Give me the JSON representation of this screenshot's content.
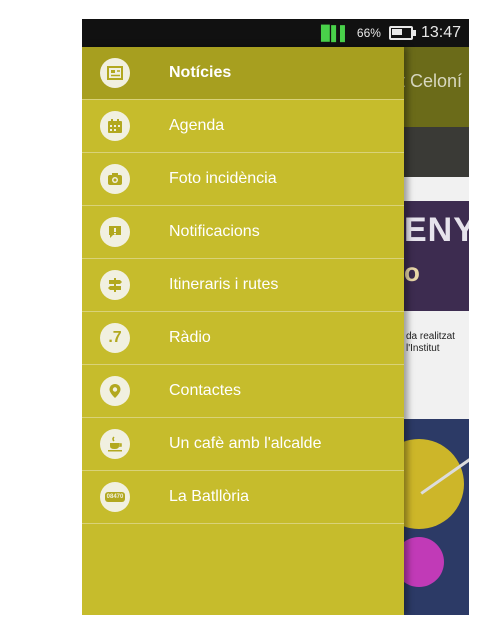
{
  "status_bar": {
    "battery_percent": "66%",
    "time": "13:47"
  },
  "background_app": {
    "title": "t Celoní",
    "banner_text": "ENY",
    "banner_sub": "o",
    "article_text": "da realitzat l'Institut"
  },
  "drawer": {
    "items": [
      {
        "label": "Notícies",
        "icon": "newspaper-icon",
        "active": true
      },
      {
        "label": "Agenda",
        "icon": "calendar-icon",
        "active": false
      },
      {
        "label": "Foto incidència",
        "icon": "camera-icon",
        "active": false
      },
      {
        "label": "Notificacions",
        "icon": "notification-icon",
        "active": false
      },
      {
        "label": "Itineraris i rutes",
        "icon": "signpost-icon",
        "active": false
      },
      {
        "label": "Ràdio",
        "icon": "radio-icon",
        "icon_text": ".7",
        "active": false
      },
      {
        "label": "Contactes",
        "icon": "location-pin-icon",
        "active": false
      },
      {
        "label": "Un cafè amb l'alcalde",
        "icon": "coffee-cup-icon",
        "active": false
      },
      {
        "label": "La Batllòria",
        "icon": "batlloria-icon",
        "icon_text": "08470",
        "active": false
      }
    ]
  },
  "colors": {
    "drawer_background": "#c6bc2c",
    "drawer_active": "#a79f1f",
    "toolbar": "#6b6b19"
  }
}
